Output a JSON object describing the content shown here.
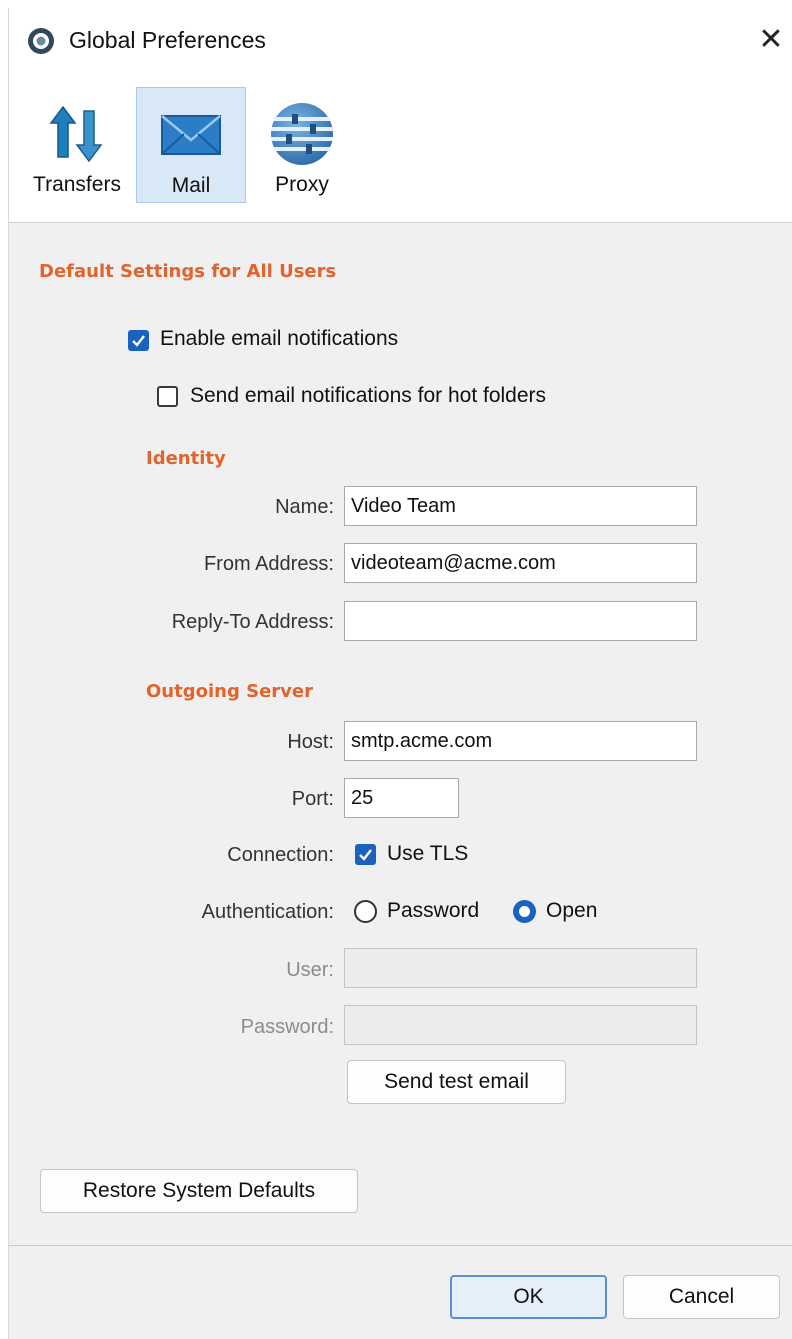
{
  "window": {
    "title": "Global Preferences",
    "close_glyph": "✕"
  },
  "toolbar": {
    "items": [
      {
        "label": "Transfers",
        "icon": "transfer-arrows-icon",
        "selected": false
      },
      {
        "label": "Mail",
        "icon": "envelope-icon",
        "selected": true
      },
      {
        "label": "Proxy",
        "icon": "globe-icon",
        "selected": false
      }
    ]
  },
  "settings": {
    "heading": "Default Settings for All Users",
    "enable_notifications": {
      "label": "Enable email notifications",
      "checked": true
    },
    "hot_folders": {
      "label": "Send email notifications for hot folders",
      "checked": false
    }
  },
  "identity": {
    "heading": "Identity",
    "name": {
      "label": "Name:",
      "value": "Video Team"
    },
    "from": {
      "label": "From Address:",
      "value": "videoteam@acme.com"
    },
    "reply_to": {
      "label": "Reply-To Address:",
      "value": ""
    }
  },
  "server": {
    "heading": "Outgoing Server",
    "host": {
      "label": "Host:",
      "value": "smtp.acme.com"
    },
    "port": {
      "label": "Port:",
      "value": "25"
    },
    "connection": {
      "label": "Connection:",
      "option_label": "Use TLS",
      "checked": true
    },
    "authentication": {
      "label": "Authentication:",
      "options": [
        {
          "label": "Password",
          "selected": false
        },
        {
          "label": "Open",
          "selected": true
        }
      ]
    },
    "user": {
      "label": "User:",
      "value": ""
    },
    "password": {
      "label": "Password:",
      "value": ""
    },
    "test_button": "Send test email"
  },
  "buttons": {
    "restore": "Restore System Defaults",
    "ok": "OK",
    "cancel": "Cancel"
  },
  "colors": {
    "accent": "#1a62c0",
    "section_heading": "#e0642b",
    "selected_tab": "#d9e8f7"
  }
}
